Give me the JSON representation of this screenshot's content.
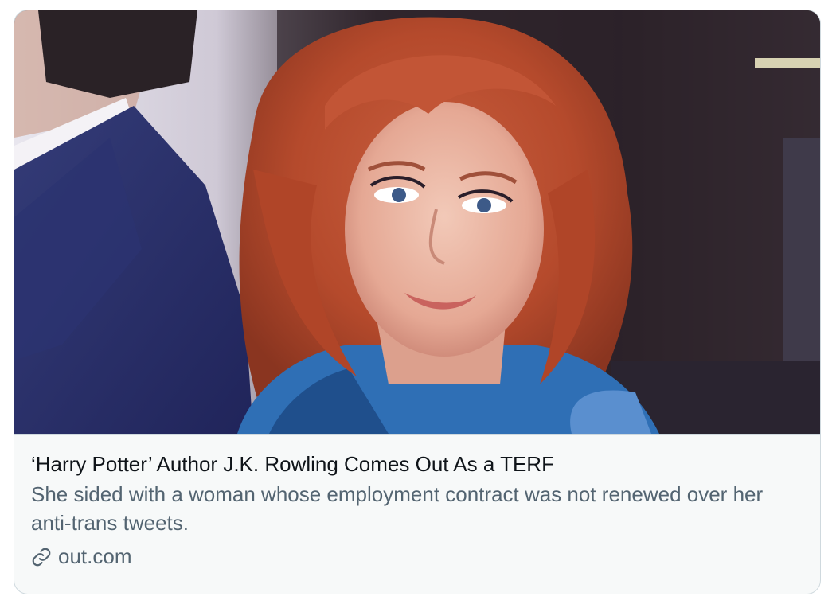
{
  "card": {
    "headline": "‘Harry Potter’ Author J.K. Rowling Comes Out As a TERF",
    "description": "She sided with a woman whose employment contract was not renewed over her anti-trans tweets.",
    "domain": "out.com",
    "icons": {
      "source": "link-icon"
    },
    "colors": {
      "headline": "#0f1419",
      "secondary": "#536471",
      "background": "#f7f9f9",
      "border": "#cfd9de"
    }
  }
}
